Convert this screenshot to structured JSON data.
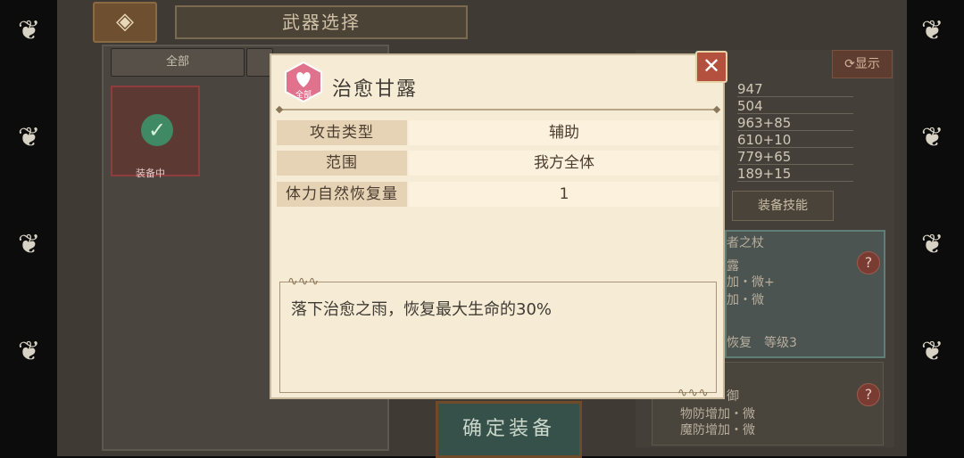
{
  "background": {
    "title": "武器选择",
    "filter_tab_all": "全部",
    "equipped_badge": "装备中",
    "display_button": "显示",
    "stats": [
      "947",
      "504",
      "963+85",
      "610+10",
      "779+65",
      "189+15"
    ],
    "skill_tab": "装备技能",
    "skill_snippets": [
      "者之杖",
      "露",
      "加・微+",
      "加・微",
      "恢复　等级3",
      "御",
      "物防增加・微",
      "魔防增加・微"
    ],
    "confirm_button": "确定装备"
  },
  "modal": {
    "badge_label": "全部",
    "title": "治愈甘露",
    "properties": [
      {
        "label": "攻击类型",
        "value": "辅助"
      },
      {
        "label": "范围",
        "value": "我方全体"
      },
      {
        "label": "体力自然恢复量",
        "value": "1"
      }
    ],
    "description": "落下治愈之雨，恢复最大生命的30%",
    "close_symbol": "✕"
  },
  "colors": {
    "modal_bg": "#f6ecd6",
    "label_bg": "#e6d2b4",
    "close_red": "#b4513e",
    "badge_pink": "#e0728d"
  }
}
